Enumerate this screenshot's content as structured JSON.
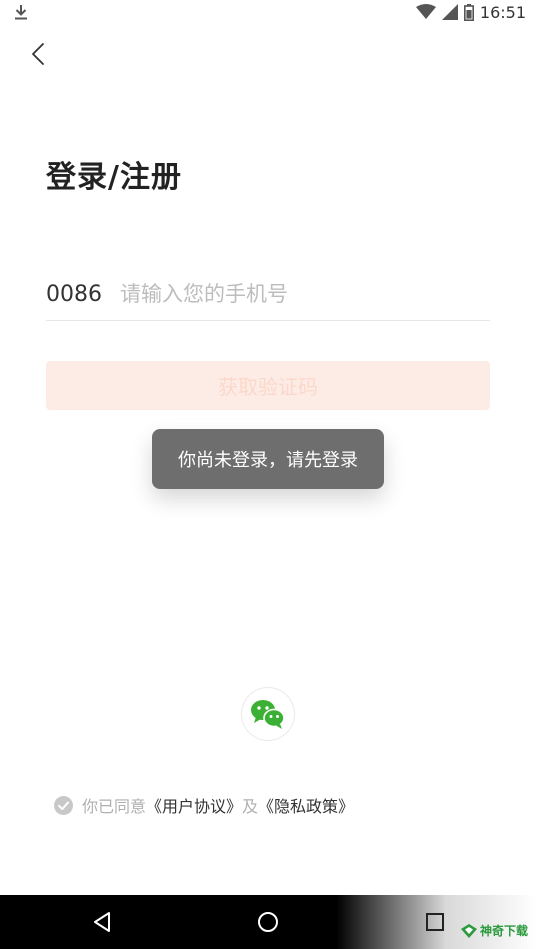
{
  "status_bar": {
    "time": "16:51",
    "icons": [
      "download-icon",
      "wifi-icon",
      "cell-signal-icon",
      "battery-icon"
    ]
  },
  "header": {
    "back_icon": "chevron-left-icon"
  },
  "title": "登录/注册",
  "phone": {
    "country_code": "0086",
    "value": "",
    "placeholder": "请输入您的手机号"
  },
  "get_code_button": {
    "label": "获取验证码",
    "enabled": false
  },
  "toast": {
    "message": "你尚未登录，请先登录"
  },
  "wechat": {
    "icon": "wechat-icon"
  },
  "agreement": {
    "checked": true,
    "prefix": "你已同意",
    "user_agreement": "《用户协议》",
    "conjunction": "及",
    "privacy_policy": "《隐私政策》"
  },
  "nav_bar": {
    "icons": [
      "nav-back-icon",
      "nav-home-icon",
      "nav-recent-icon"
    ]
  },
  "watermark": {
    "text": "神奇下载"
  },
  "colors": {
    "accent_disabled_bg": "#fdece5",
    "accent_disabled_text": "#fbd8ca",
    "toast_bg": "#6e6e6e",
    "wechat_green": "#3cb034"
  }
}
